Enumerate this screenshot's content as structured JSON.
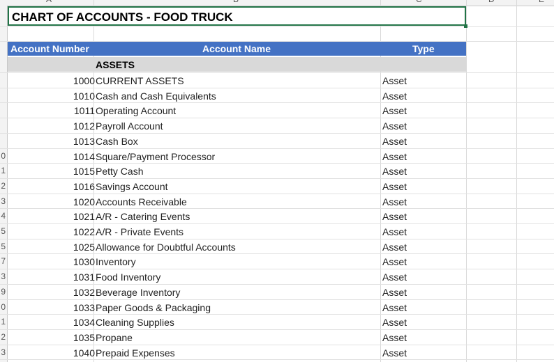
{
  "columns": [
    "A",
    "B",
    "C",
    "D",
    "E"
  ],
  "row_numbers": [
    "0",
    "1",
    "2",
    "3",
    "4",
    "5",
    "5",
    "7",
    "3",
    "9",
    "0",
    "1",
    "2",
    "3"
  ],
  "title": "CHART OF ACCOUNTS - FOOD TRUCK",
  "header": {
    "account_number": "Account Number",
    "account_name": "Account Name",
    "type": "Type"
  },
  "section": "ASSETS",
  "accounts": [
    {
      "number": "1000",
      "name": "CURRENT ASSETS",
      "type": "Asset"
    },
    {
      "number": "1010",
      "name": "Cash and Cash Equivalents",
      "type": "Asset"
    },
    {
      "number": "1011",
      "name": "Operating Account",
      "type": "Asset"
    },
    {
      "number": "1012",
      "name": "Payroll Account",
      "type": "Asset"
    },
    {
      "number": "1013",
      "name": "Cash Box",
      "type": "Asset"
    },
    {
      "number": "1014",
      "name": "Square/Payment Processor",
      "type": "Asset"
    },
    {
      "number": "1015",
      "name": "Petty Cash",
      "type": "Asset"
    },
    {
      "number": "1016",
      "name": "Savings Account",
      "type": "Asset"
    },
    {
      "number": "1020",
      "name": "Accounts Receivable",
      "type": "Asset"
    },
    {
      "number": "1021",
      "name": "A/R - Catering Events",
      "type": "Asset"
    },
    {
      "number": "1022",
      "name": "A/R - Private Events",
      "type": "Asset"
    },
    {
      "number": "1025",
      "name": "Allowance for Doubtful Accounts",
      "type": "Asset"
    },
    {
      "number": "1030",
      "name": "Inventory",
      "type": "Asset"
    },
    {
      "number": "1031",
      "name": "Food Inventory",
      "type": "Asset"
    },
    {
      "number": "1032",
      "name": "Beverage Inventory",
      "type": "Asset"
    },
    {
      "number": "1033",
      "name": "Paper Goods & Packaging",
      "type": "Asset"
    },
    {
      "number": "1034",
      "name": "Cleaning Supplies",
      "type": "Asset"
    },
    {
      "number": "1035",
      "name": "Propane",
      "type": "Asset"
    },
    {
      "number": "1040",
      "name": "Prepaid Expenses",
      "type": "Asset"
    }
  ],
  "colors": {
    "header_bg": "#4472c4",
    "section_bg": "#d9d9d9",
    "selection": "#217346"
  }
}
